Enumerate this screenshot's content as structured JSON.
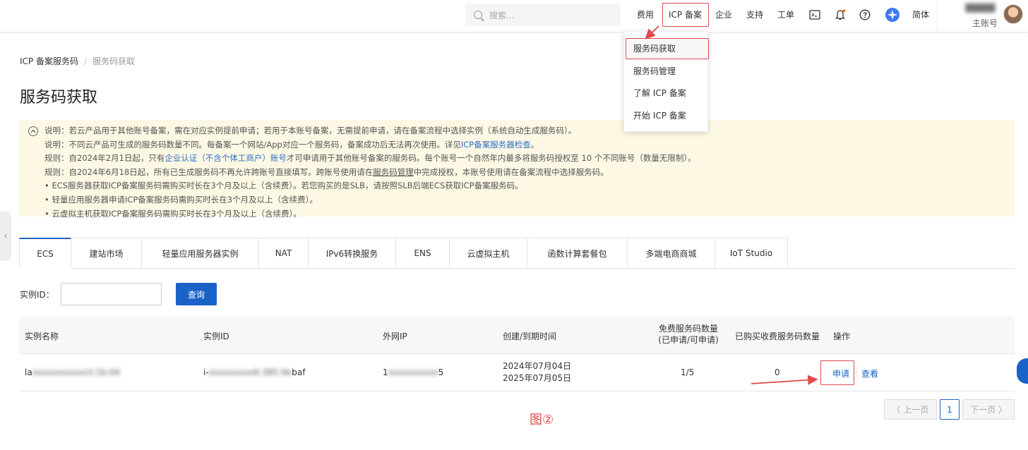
{
  "topbar": {
    "search_placeholder": "搜索...",
    "nav": {
      "fees": "费用",
      "icp": "ICP 备案",
      "enterprise": "企业",
      "support": "支持",
      "ticket": "工单",
      "lang": "简体"
    },
    "account_name": "主账号",
    "account_blurred": "▓▓▓▓▓"
  },
  "dropdown": {
    "items": [
      "服务码获取",
      "服务码管理",
      "了解 ICP 备案",
      "开始 ICP 备案"
    ]
  },
  "breadcrumb": {
    "parent": "ICP 备案服务码",
    "current": "服务码获取"
  },
  "page_title": "服务码获取",
  "notice": {
    "line1": "说明：若云产品用于其他账号备案，需在对应实例提前申请；若用于本账号备案，无需提前申请，请在备案流程中选择实例（系统自动生成服务码）。",
    "line2_pre": "说明：不同云产品可生成的服务码数量不同。每备案一个网站/App对应一个服务码，备案成功后无法再次使用。详见",
    "line2_link": "ICP备案服务器检查",
    "line2_post": "。",
    "line3_pre": "规则：自",
    "line3_date": "2024年2月1日",
    "line3_mid": "起，只有",
    "line3_link": "企业认证（不含个体工商户）账号",
    "line3_post": "才可申请用于其他账号备案的服务码。每个账号一个自然年内最多将服务码授权至 10 个不同账号（数量无限制）。",
    "line4_pre": "规则：自",
    "line4_date": "2024年6月18日",
    "line4_mid": "起，所有已生成服务码不再允许跨账号直接填写。跨账号使用请在",
    "line4_link": "服务码管理",
    "line4_post": "中完成授权，本账号使用请在备案流程中选择服务码。",
    "line5": "• ECS服务器获取ICP备案服务码需购买时长在3个月及以上（含续费）。若您购买的是SLB，请按照SLB后端ECS获取ICP备案服务码。",
    "line6": "• 轻量应用服务器申请ICP备案服务码需购买时长在3个月及以上（含续费）。",
    "line7": "• 云虚拟主机获取ICP备案服务码需购买时长在3个月及以上（含续费）。"
  },
  "tabs": [
    "ECS",
    "建站市场",
    "轻量应用服务器实例",
    "NAT",
    "IPv6转换服务",
    "ENS",
    "云虚拟主机",
    "函数计算套餐包",
    "多端电商商城",
    "IoT Studio"
  ],
  "filter": {
    "label": "实例ID：",
    "value": "",
    "button": "查询"
  },
  "table": {
    "headers": {
      "name": "实例名称",
      "id": "实例ID",
      "ip": "外网IP",
      "time": "创建/到期时间",
      "free_line1": "免费服务码数量",
      "free_line2": "(已申请/可申请)",
      "paid": "已购买收费服务码数量",
      "ops": "操作"
    },
    "rows": [
      {
        "name_visible": "la",
        "name_hidden": "xxxxxxxxxxx3:1b:04",
        "id_visible_start": "i-",
        "id_hidden": "xxxxxxxxx6:385:9e",
        "id_visible_end": "baf",
        "ip_visible_start": "1",
        "ip_hidden": "xxxxxxxxxx",
        "ip_visible_end": "5",
        "created": "2024年07月04日",
        "expires": "2025年07月05日",
        "free": "1/5",
        "paid": "0",
        "apply": "申请",
        "view": "查看"
      }
    ]
  },
  "pagination": {
    "prev": "〈 上一页",
    "current": "1",
    "next": "下一页 〉"
  },
  "caption": "图②",
  "colors": {
    "accent": "#1a62c8",
    "annotation": "#e04a4a",
    "notice_bg": "#fdf8e4"
  }
}
